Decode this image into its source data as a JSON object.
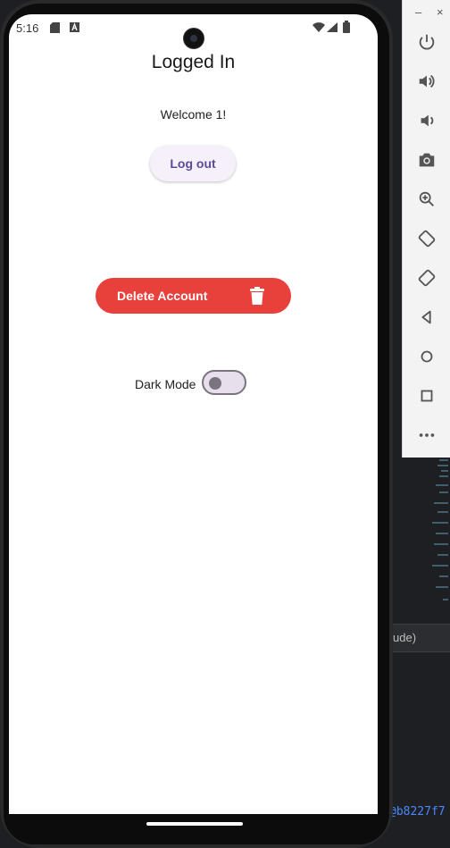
{
  "status_bar": {
    "time": "5:16"
  },
  "screen": {
    "title": "Logged In",
    "welcome": "Welcome 1!",
    "logout_label": "Log out",
    "delete_label": "Delete Account",
    "dark_mode_label": "Dark Mode",
    "dark_mode_on": false
  },
  "emulator_toolbar": {
    "buttons": [
      "power-icon",
      "volume-up-icon",
      "volume-down-icon",
      "camera-icon",
      "zoom-icon",
      "rotate-left-icon",
      "rotate-right-icon",
      "back-icon",
      "home-icon",
      "overview-icon",
      "more-icon"
    ]
  },
  "ide": {
    "tab_text": "ude)",
    "commit_hash": "@b8227f7"
  },
  "colors": {
    "accent_purple": "#5b4a96",
    "danger_red": "#e8403b",
    "toggle_track": "#e7e0ec"
  }
}
